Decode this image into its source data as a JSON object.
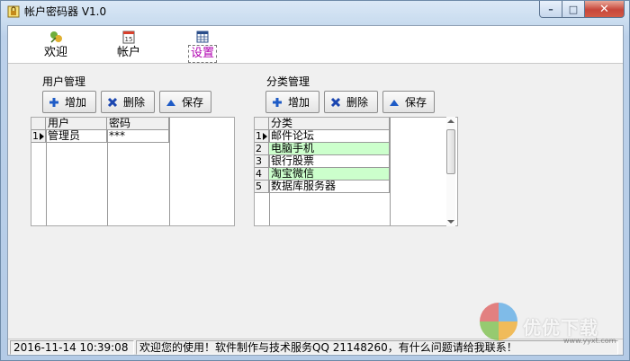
{
  "window": {
    "title": "帐户密码器 V1.0",
    "app_icon": "lock-app-icon"
  },
  "caption": {
    "minimize": "–",
    "maximize": "□",
    "close": "✕"
  },
  "nav": [
    {
      "label": "欢迎",
      "icon": "welcome-icon"
    },
    {
      "label": "帐户",
      "icon": "calendar-icon"
    },
    {
      "label": "设置",
      "icon": "table-icon",
      "active": true
    }
  ],
  "user_group": {
    "title": "用户管理",
    "buttons": {
      "add": "增加",
      "delete": "删除",
      "save": "保存"
    },
    "columns": [
      "用户",
      "密码"
    ],
    "rows": [
      {
        "index": "1",
        "user": "管理员",
        "password": "***"
      }
    ]
  },
  "category_group": {
    "title": "分类管理",
    "buttons": {
      "add": "增加",
      "delete": "删除",
      "save": "保存"
    },
    "columns": [
      "分类"
    ],
    "rows": [
      {
        "index": "1",
        "name": "邮件论坛"
      },
      {
        "index": "2",
        "name": "电脑手机"
      },
      {
        "index": "3",
        "name": "银行股票"
      },
      {
        "index": "4",
        "name": "淘宝微信"
      },
      {
        "index": "5",
        "name": "数据库服务器"
      }
    ]
  },
  "status": {
    "datetime": "2016-11-14 10:39:08",
    "message": "欢迎您的使用！软件制作与技术服务QQ 21148260，有什么问题请给我联系！"
  },
  "watermark": {
    "text": "优优下载",
    "url": "www.yyxt.com"
  },
  "colors": {
    "alt_row": "#ccffcc",
    "active_tab": "#b000b0",
    "accent_blue": "#1e5bc6",
    "accent_red": "#1b46b0"
  }
}
